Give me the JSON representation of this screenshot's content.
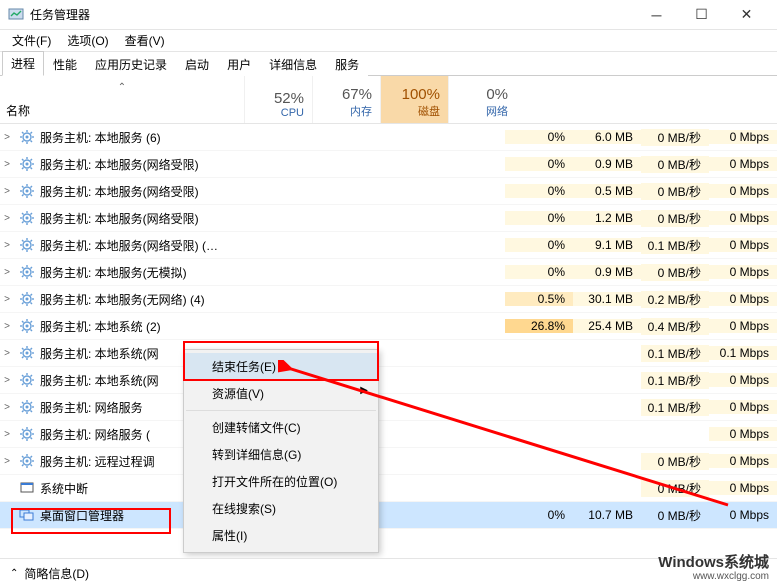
{
  "window": {
    "title": "任务管理器"
  },
  "menu": {
    "file": "文件(F)",
    "options": "选项(O)",
    "view": "查看(V)"
  },
  "tabs": [
    "进程",
    "性能",
    "应用历史记录",
    "启动",
    "用户",
    "详细信息",
    "服务"
  ],
  "columns": {
    "name": "名称",
    "cpu": {
      "pct": "52%",
      "label": "CPU"
    },
    "mem": {
      "pct": "67%",
      "label": "内存"
    },
    "disk": {
      "pct": "100%",
      "label": "磁盘"
    },
    "net": {
      "pct": "0%",
      "label": "网络"
    }
  },
  "rows": [
    {
      "exp": ">",
      "name": "服务主机: 本地服务 (6)",
      "cpu": "0%",
      "mem": "6.0 MB",
      "disk": "0 MB/秒",
      "net": "0 Mbps"
    },
    {
      "exp": ">",
      "name": "服务主机: 本地服务(网络受限)",
      "cpu": "0%",
      "mem": "0.9 MB",
      "disk": "0 MB/秒",
      "net": "0 Mbps"
    },
    {
      "exp": ">",
      "name": "服务主机: 本地服务(网络受限)",
      "cpu": "0%",
      "mem": "0.5 MB",
      "disk": "0 MB/秒",
      "net": "0 Mbps"
    },
    {
      "exp": ">",
      "name": "服务主机: 本地服务(网络受限)",
      "cpu": "0%",
      "mem": "1.2 MB",
      "disk": "0 MB/秒",
      "net": "0 Mbps"
    },
    {
      "exp": ">",
      "name": "服务主机: 本地服务(网络受限) (…",
      "cpu": "0%",
      "mem": "9.1 MB",
      "disk": "0.1 MB/秒",
      "net": "0 Mbps"
    },
    {
      "exp": ">",
      "name": "服务主机: 本地服务(无模拟)",
      "cpu": "0%",
      "mem": "0.9 MB",
      "disk": "0 MB/秒",
      "net": "0 Mbps"
    },
    {
      "exp": ">",
      "name": "服务主机: 本地服务(无网络) (4)",
      "cpu": "0.5%",
      "mem": "30.1 MB",
      "disk": "0.2 MB/秒",
      "net": "0 Mbps"
    },
    {
      "exp": ">",
      "name": "服务主机: 本地系统 (2)",
      "cpu": "26.8%",
      "mem": "25.4 MB",
      "disk": "0.4 MB/秒",
      "net": "0 Mbps"
    },
    {
      "exp": ">",
      "name": "服务主机: 本地系统(网",
      "cpu": "",
      "mem": "",
      "disk": "0.1 MB/秒",
      "net": "0.1 Mbps"
    },
    {
      "exp": ">",
      "name": "服务主机: 本地系统(网",
      "cpu": "",
      "mem": "",
      "disk": "0.1 MB/秒",
      "net": "0 Mbps"
    },
    {
      "exp": ">",
      "name": "服务主机: 网络服务",
      "cpu": "",
      "mem": "",
      "disk": "0.1 MB/秒",
      "net": "0 Mbps"
    },
    {
      "exp": ">",
      "name": "服务主机: 网络服务 (",
      "cpu": "",
      "mem": "",
      "disk": "",
      "net": "0 Mbps"
    },
    {
      "exp": ">",
      "name": "服务主机: 远程过程调",
      "cpu": "",
      "mem": "",
      "disk": "0 MB/秒",
      "net": "0 Mbps"
    },
    {
      "exp": "",
      "name": "系统中断",
      "cpu": "",
      "mem": "",
      "disk": "0 MB/秒",
      "net": "0 Mbps",
      "icon": "sys"
    },
    {
      "exp": "",
      "name": "桌面窗口管理器",
      "cpu": "0%",
      "mem": "10.7 MB",
      "disk": "0 MB/秒",
      "net": "0 Mbps",
      "sel": true,
      "icon": "dwm"
    }
  ],
  "context_menu": {
    "end_task": "结束任务(E)",
    "resource_values": "资源值(V)",
    "create_dump": "创建转储文件(C)",
    "go_details": "转到详细信息(G)",
    "open_location": "打开文件所在的位置(O)",
    "search_online": "在线搜索(S)",
    "properties": "属性(I)"
  },
  "footer": {
    "brief": "简略信息(D)"
  },
  "watermark": {
    "main": "Windows系统城",
    "sub": "www.wxclgg.com"
  }
}
